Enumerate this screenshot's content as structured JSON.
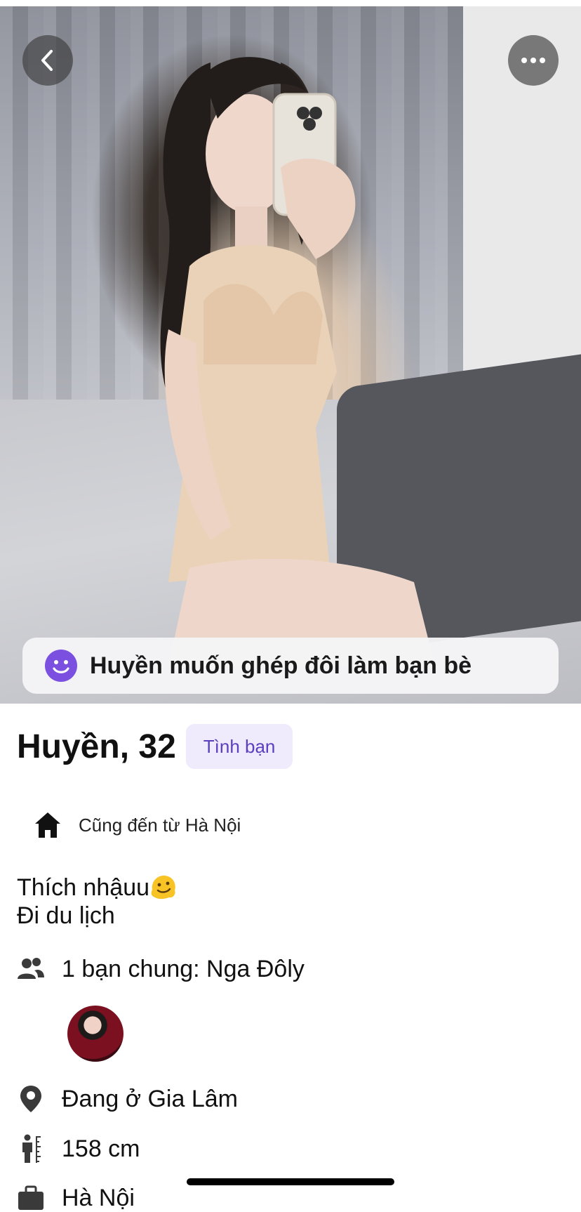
{
  "header": {
    "back_icon": "chevron-left-icon",
    "more_icon": "more-horizontal-icon"
  },
  "match_banner": {
    "icon": "smile-icon",
    "text": "Huyền muốn ghép đôi làm bạn bè",
    "icon_color": "#7b4fe0"
  },
  "profile": {
    "name_age": "Huyền, 32",
    "tag": "Tình bạn",
    "hometown": "Cũng đến từ Hà Nội",
    "bio_line1": "Thích nhậuu",
    "bio_emoji": "melting-face-emoji",
    "bio_line2": "Đi du lịch",
    "mutual_friends": "1 bạn chung: Nga Đôly",
    "location": "Đang ở Gia Lâm",
    "height": "158 cm",
    "work_partial": "Hà Nội"
  },
  "colors": {
    "accent": "#5b3fbe",
    "tag_bg": "#efebfc",
    "text": "#111111",
    "icon": "#3a3a3a"
  }
}
